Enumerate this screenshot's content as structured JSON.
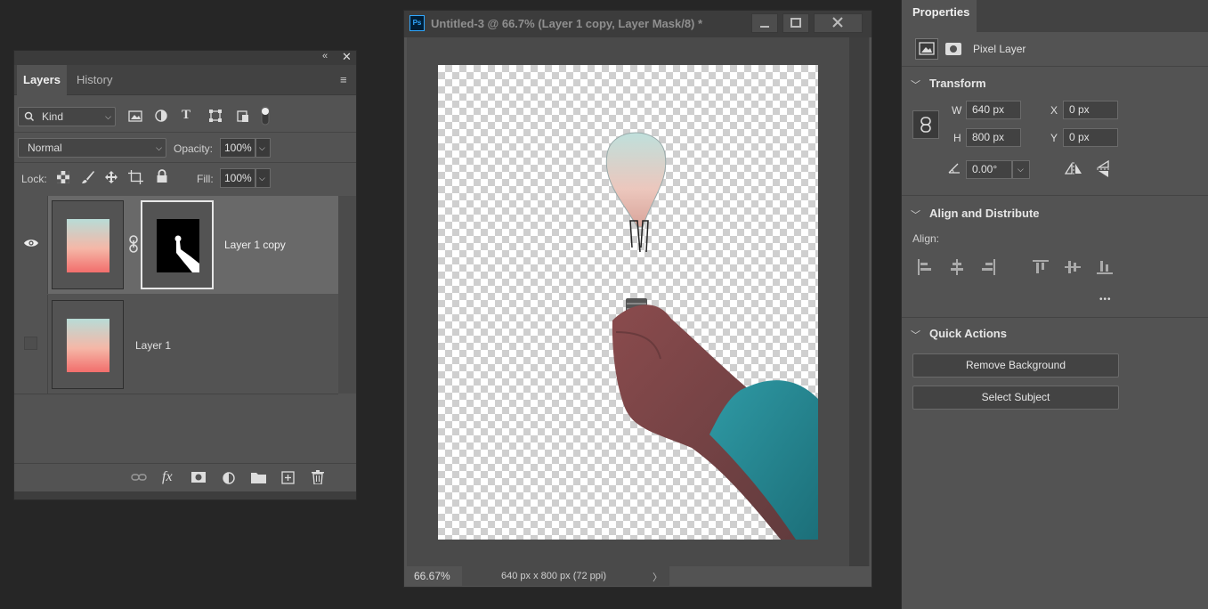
{
  "layers_panel": {
    "tabs": [
      "Layers",
      "History"
    ],
    "filter": {
      "value": "Kind"
    },
    "blend_mode": "Normal",
    "opacity_label": "Opacity:",
    "opacity_value": "100%",
    "lock_label": "Lock:",
    "fill_label": "Fill:",
    "fill_value": "100%",
    "layers": [
      {
        "name": "Layer 1 copy",
        "visible": true,
        "has_mask": true,
        "selected": true
      },
      {
        "name": "Layer 1",
        "visible": false,
        "has_mask": false,
        "selected": false
      }
    ],
    "footer_icons": [
      "link-icon",
      "fx-icon",
      "mask-icon",
      "adjustment-icon",
      "folder-icon",
      "new-layer-icon",
      "trash-icon"
    ]
  },
  "document": {
    "title": "Untitled-3 @ 66.7% (Layer 1 copy, Layer Mask/8) *",
    "app_badge": "Ps",
    "zoom": "66.67%",
    "doc_info": "640 px x 800 px (72 ppi)",
    "status_arrow": "〉"
  },
  "properties": {
    "tab": "Properties",
    "layer_type": "Pixel Layer",
    "transform": {
      "title": "Transform",
      "w_label": "W",
      "w_value": "640 px",
      "h_label": "H",
      "h_value": "800 px",
      "x_label": "X",
      "x_value": "0 px",
      "y_label": "Y",
      "y_value": "0 px",
      "angle_value": "0.00°"
    },
    "align": {
      "title": "Align and Distribute",
      "label": "Align:",
      "more": "•••"
    },
    "quick_actions": {
      "title": "Quick Actions",
      "remove_bg": "Remove Background",
      "select_subject": "Select Subject"
    }
  },
  "colors": {
    "panel": "#535353",
    "workspace": "#262626",
    "accent": "#1473e6"
  }
}
